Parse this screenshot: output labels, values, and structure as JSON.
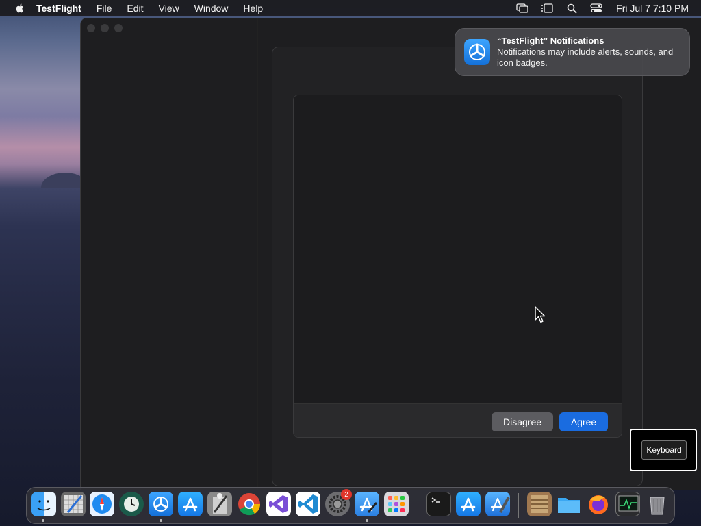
{
  "menubar": {
    "app_name": "TestFlight",
    "items": [
      "File",
      "Edit",
      "View",
      "Window",
      "Help"
    ],
    "clock": "Fri Jul 7  7:10 PM"
  },
  "notification": {
    "title": "“TestFlight” Notifications",
    "body": "Notifications may include alerts, sounds, and icon badges."
  },
  "sheet": {
    "disagree_label": "Disagree",
    "agree_label": "Agree"
  },
  "keyboard_overlay": {
    "label": "Keyboard"
  },
  "dock": {
    "settings_badge": "2",
    "items": [
      "finder",
      "sketchbook",
      "safari",
      "time-machine",
      "testflight",
      "app-store",
      "script-editor",
      "chrome",
      "visual-studio",
      "vscode",
      "system-settings",
      "xcode-simulator",
      "launchpad",
      "terminal",
      "app-store-2",
      "xcode",
      "archive",
      "folder",
      "firefox",
      "activity-monitor",
      "trash"
    ]
  },
  "colors": {
    "accent": "#1a6ce0",
    "badge": "#e0352b"
  }
}
